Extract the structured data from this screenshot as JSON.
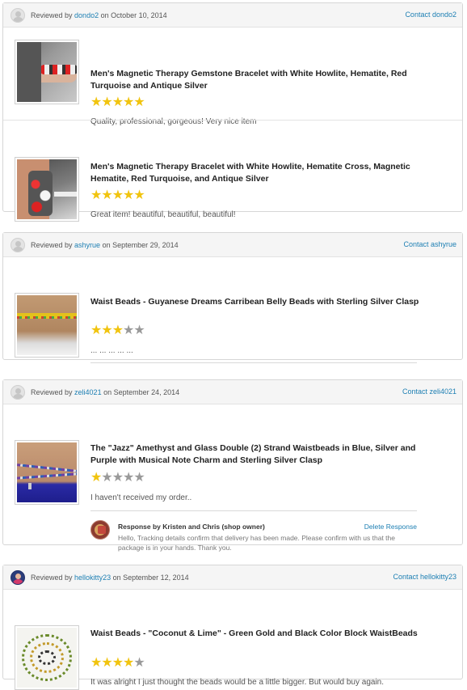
{
  "rating_max": 5,
  "reviews": [
    {
      "reviewed_prefix": "Reviewed by",
      "username": "dondo2",
      "date": "on October 10, 2014",
      "contact_label": "Contact dondo2",
      "items": [
        {
          "title": "Men's Magnetic Therapy Gemstone Bracelet with White Howlite, Hematite, Red Turquoise and Antique Silver",
          "rating": 5,
          "text": "Quality, professional, gorgeous! Very nice item"
        },
        {
          "title": "Men's Magnetic Therapy Bracelet with White Howlite, Hematite Cross, Magnetic Hematite, Red Turquoise, and Antique Silver",
          "rating": 5,
          "text": "Great item! beautiful, beautiful, beautiful!"
        }
      ]
    },
    {
      "reviewed_prefix": "Reviewed by",
      "username": "ashyrue",
      "date": "on September 29, 2014",
      "contact_label": "Contact ashyrue",
      "items": [
        {
          "title": "Waist Beads - Guyanese Dreams Carribean Belly Beads with Sterling Silver Clasp",
          "rating": 3,
          "text": "... ... ... ... ..."
        }
      ]
    },
    {
      "reviewed_prefix": "Reviewed by",
      "username": "zeli4021",
      "date": "on September 24, 2014",
      "contact_label": "Contact zeli4021",
      "items": [
        {
          "title": "The \"Jazz\" Amethyst and Glass Double (2) Strand Waistbeads in Blue, Silver and Purple with Musical Note Charm and Sterling Silver Clasp",
          "rating": 1,
          "text": "I haven't received my order..",
          "response": {
            "title": "Response by Kristen and Chris (shop owner)",
            "delete_label": "Delete Response",
            "text": "Hello, Tracking details confirm that delivery has been made. Please confirm with us that the package is in your hands. Thank you."
          }
        }
      ]
    },
    {
      "reviewed_prefix": "Reviewed by",
      "username": "hellokitty23",
      "date": "on September 12, 2014",
      "contact_label": "Contact hellokitty23",
      "items": [
        {
          "title": "Waist Beads - \"Coconut & Lime\" - Green Gold and Black Color Block WaistBeads",
          "rating": 4,
          "text": "It was alright I just thought the beads would be a little bigger. But would buy again."
        }
      ]
    }
  ]
}
